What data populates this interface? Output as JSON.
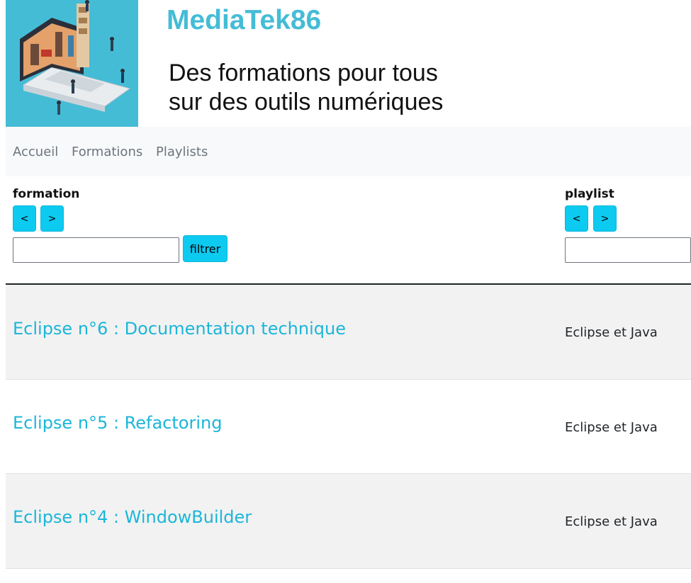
{
  "header": {
    "site_title": "MediaTek86",
    "tagline_line1": "Des formations pour tous",
    "tagline_line2": "sur des outils numériques"
  },
  "nav": {
    "items": [
      {
        "label": "Accueil"
      },
      {
        "label": "Formations"
      },
      {
        "label": "Playlists"
      }
    ]
  },
  "columns": {
    "formation": {
      "label": "formation",
      "sort_asc": "<",
      "sort_desc": ">",
      "filter_value": "",
      "filter_button": "filtrer"
    },
    "playlist": {
      "label": "playlist",
      "sort_asc": "<",
      "sort_desc": ">",
      "filter_value": ""
    }
  },
  "rows": [
    {
      "title": "Eclipse n°6 : Documentation technique",
      "playlist": "Eclipse et Java"
    },
    {
      "title": "Eclipse n°5 : Refactoring",
      "playlist": "Eclipse et Java"
    },
    {
      "title": "Eclipse n°4 : WindowBuilder",
      "playlist": "Eclipse et Java"
    }
  ],
  "colors": {
    "accent": "#0dcaf0",
    "title_blue": "#45bcd6",
    "link_blue": "#1cb6d8"
  }
}
